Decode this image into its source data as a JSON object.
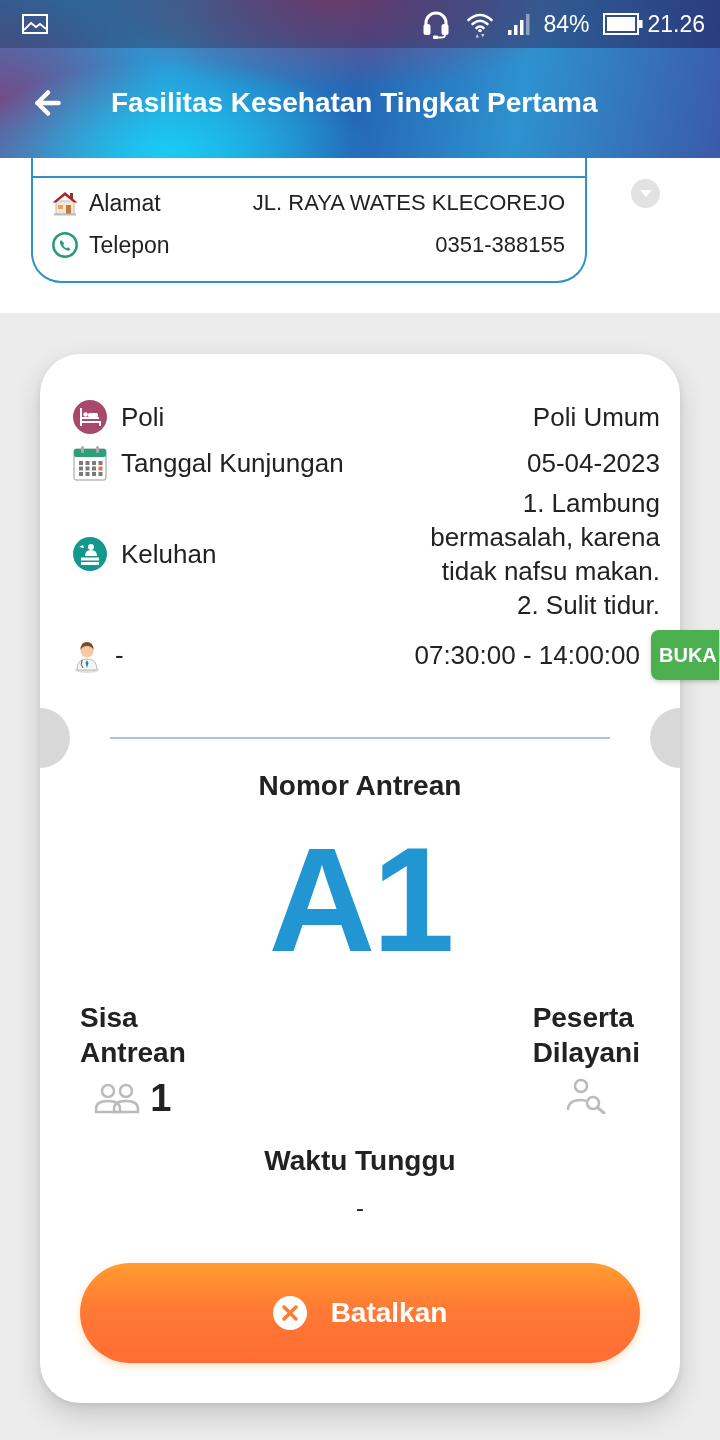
{
  "status_bar": {
    "battery": "84%",
    "time": "21.26"
  },
  "app_bar": {
    "title": "Fasilitas Kesehatan Tingkat Pertama"
  },
  "facility": {
    "rows": [
      {
        "kind": "address",
        "label": "Alamat",
        "value": "JL. RAYA WATES KLECOREJO"
      },
      {
        "kind": "phone",
        "label": "Telepon",
        "value": "0351-388155"
      }
    ]
  },
  "visit": {
    "rows": [
      {
        "kind": "clinic",
        "label": "Poli",
        "value": "Poli Umum"
      },
      {
        "kind": "date",
        "label": "Tanggal Kunjungan",
        "value": "05-04-2023"
      },
      {
        "kind": "complaint",
        "label": "Keluhan",
        "items": [
          "1. Lambung bermasalah, karena tidak nafsu makan.",
          "2. Sulit tidur."
        ]
      },
      {
        "kind": "doctor",
        "label": "-",
        "value": "07:30:00 - 14:00:00",
        "badge": "BUKA"
      }
    ]
  },
  "queue": {
    "title": "Nomor Antrean",
    "number": "A1",
    "remaining": {
      "label": "Sisa Antrean",
      "count": "1"
    },
    "served": {
      "label": "Peserta Dilayani"
    },
    "wait": {
      "label": "Waktu Tunggu",
      "value": "-"
    }
  },
  "cancel_button": {
    "label": "Batalkan"
  }
}
